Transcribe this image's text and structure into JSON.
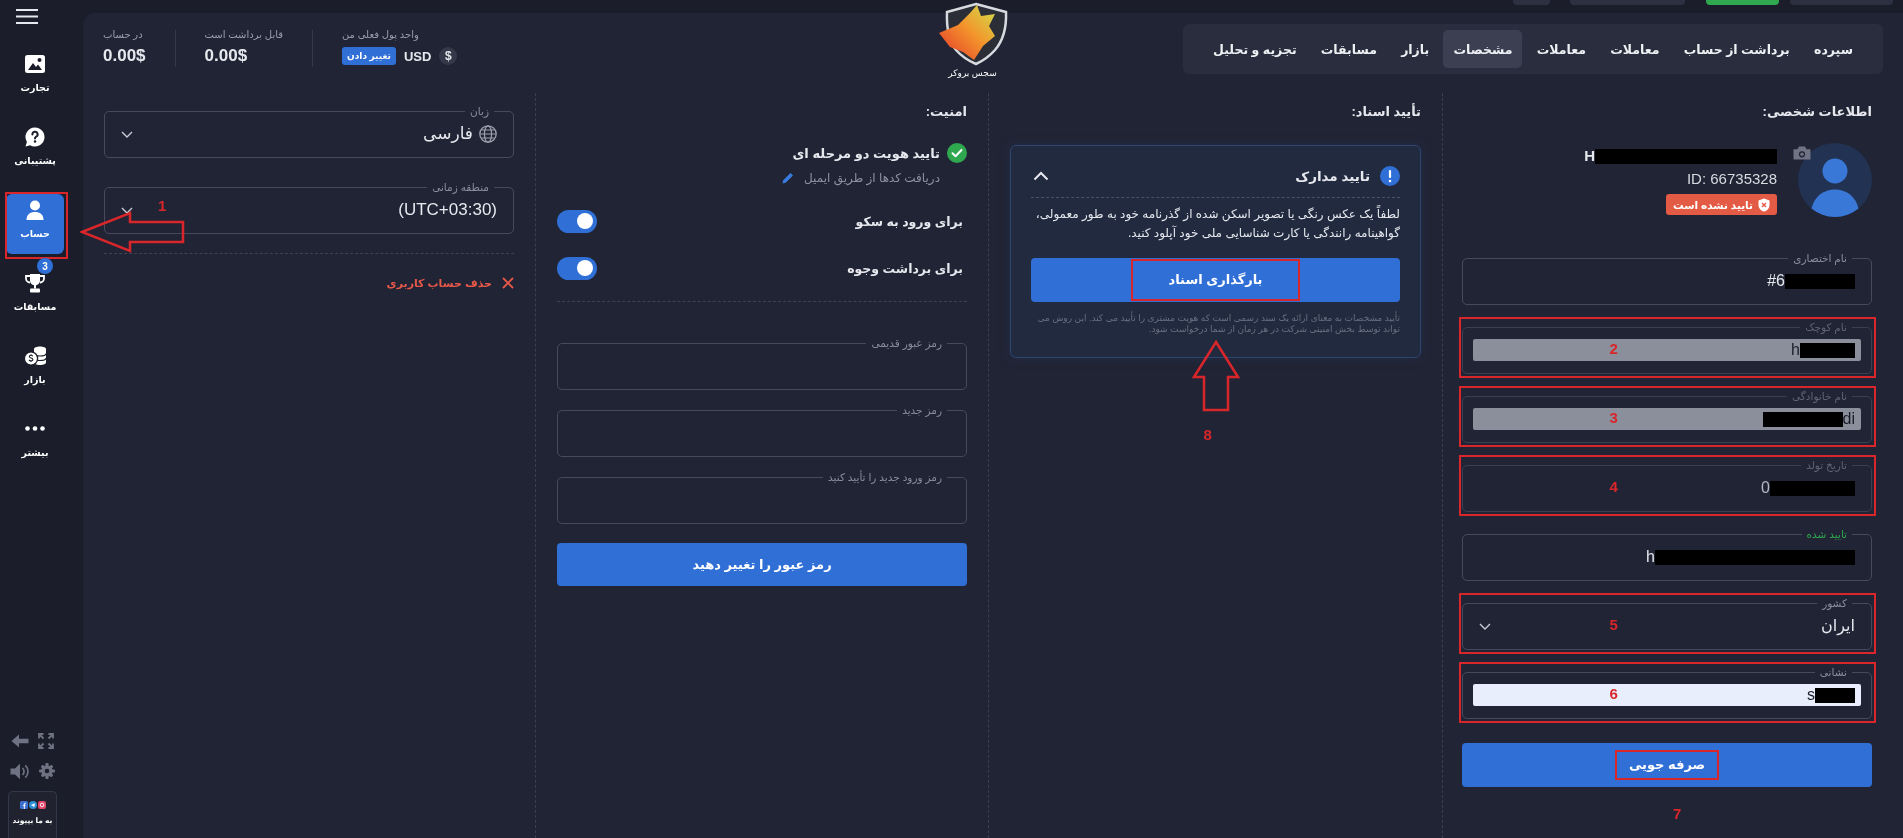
{
  "top_buttons": [
    {
      "kind": "secondary"
    },
    {
      "kind": "secondary"
    },
    {
      "kind": "primary"
    },
    {
      "kind": "secondary"
    }
  ],
  "sidebar": {
    "items": [
      {
        "label": "تجارت",
        "selected": false
      },
      {
        "label": "پشتیبانی",
        "selected": false
      },
      {
        "label": "حساب",
        "selected": true,
        "callout": {
          "number": "1",
          "arrow": true
        }
      },
      {
        "label": "مسابقات",
        "selected": false,
        "badge": "3"
      },
      {
        "label": "بازار",
        "selected": false
      },
      {
        "label": "بیشتر",
        "selected": false
      }
    ],
    "join_label": "به ما بپیوند"
  },
  "header": {
    "tabs": [
      {
        "label": "سپرده",
        "selected": false
      },
      {
        "label": "برداشت از حساب",
        "selected": false
      },
      {
        "label": "معاملات",
        "selected": false
      },
      {
        "label": "معاملات",
        "selected": false
      },
      {
        "label": "مشخصات",
        "selected": true
      },
      {
        "label": "بازار",
        "selected": false
      },
      {
        "label": "مسابقات",
        "selected": false
      },
      {
        "label": "تجزیه و تحلیل",
        "selected": false
      }
    ],
    "logo_text": "سجس بروکر",
    "balances": [
      {
        "kind": "currency",
        "label": "واحد پول فعلی من",
        "symbol": "$",
        "currency": "USD",
        "action": "تغییر دادن"
      },
      {
        "kind": "amount",
        "label": "قابل برداشت است",
        "value": "0.00$"
      },
      {
        "kind": "amount",
        "label": "در حساب",
        "value": "0.00$"
      }
    ]
  },
  "personal": {
    "title": "اطلاعات شخصی:",
    "profile": {
      "name": [
        {
          "kind": "text",
          "text": "H"
        },
        {
          "kind": "redaction"
        }
      ],
      "id": "ID: 66735328",
      "status": "تایید نشده است",
      "verified": false
    },
    "fields": [
      {
        "label": "نام اختصاری",
        "kind": "text",
        "verified": false,
        "disabled": false,
        "autofilled": false,
        "value": [
          {
            "kind": "text",
            "text": "#6"
          },
          {
            "kind": "redaction"
          }
        ]
      },
      {
        "label": "نام کوچک",
        "kind": "text",
        "verified": false,
        "disabled": true,
        "autofilled": true,
        "value": [
          {
            "kind": "text",
            "text": "h"
          },
          {
            "kind": "redaction"
          }
        ],
        "callout": {
          "number": "2"
        }
      },
      {
        "label": "نام خانوادگی",
        "kind": "text",
        "verified": false,
        "disabled": true,
        "autofilled": true,
        "value": [
          {
            "kind": "redaction"
          },
          {
            "kind": "text",
            "text": "di"
          }
        ],
        "callout": {
          "number": "3"
        }
      },
      {
        "label": "تاریخ تولد",
        "kind": "text",
        "verified": false,
        "disabled": true,
        "autofilled": false,
        "value": [
          {
            "kind": "text",
            "text": "0"
          },
          {
            "kind": "redaction"
          }
        ],
        "callout": {
          "number": "4"
        }
      },
      {
        "label": "تایید شده",
        "kind": "text",
        "verified": true,
        "disabled": false,
        "autofilled": false,
        "value": [
          {
            "kind": "text",
            "text": "h"
          },
          {
            "kind": "redaction"
          }
        ]
      },
      {
        "label": "کشور",
        "kind": "select",
        "verified": false,
        "disabled": false,
        "autofilled": false,
        "value": [
          {
            "kind": "text",
            "text": "ایران"
          }
        ],
        "callout": {
          "number": "5"
        }
      },
      {
        "label": "نشانی",
        "kind": "text",
        "verified": false,
        "disabled": false,
        "autofilled": true,
        "value": [
          {
            "kind": "text",
            "text": "s"
          },
          {
            "kind": "redaction"
          }
        ],
        "callout": {
          "number": "6"
        }
      }
    ],
    "save": {
      "label": "صرفه جویی",
      "callout": {
        "number": "7"
      }
    }
  },
  "documents": {
    "title": "تأیید اسناد:",
    "card": {
      "title": "تایید مدارک",
      "expanded": true,
      "message": "لطفاً یک عکس رنگی یا تصویر اسکن شده از گذرنامه خود به طور معمولی، گواهینامه رانندگی یا کارت شناسایی ملی خود آپلود کنید.",
      "upload": {
        "label": "بارگذاری اسناد",
        "callout": {
          "number": "8",
          "arrow": true
        }
      },
      "note": "تأیید مشخصات به معنای ارائه یک سند رسمی است که هویت مشتری را تأیید می کند. این روش می تواند توسط بخش امنیتی شرکت در هر زمان از شما درخواست شود."
    }
  },
  "security": {
    "title": "امنیت:",
    "two_factor": {
      "title": "تایید هویت دو مرحله ای",
      "enabled": true,
      "method": "دریافت کدها از طریق ایمیل"
    },
    "toggles": [
      {
        "label": "برای ورود به سکو",
        "on": true
      },
      {
        "label": "برای برداشت وجوه",
        "on": true
      }
    ],
    "password_fields": [
      {
        "label": "رمز عبور قدیمی"
      },
      {
        "label": "رمز جدید"
      },
      {
        "label": "رمز ورود جدید را تأیید کنید"
      }
    ],
    "submit": "رمز عبور را تغییر دهید"
  },
  "settings": {
    "fields": [
      {
        "kind": "language",
        "label": "زبان",
        "value": "فارسی"
      },
      {
        "kind": "select",
        "label": "منطقه زمانی",
        "value": "(UTC+03:30)"
      }
    ],
    "delete_account": "حذف حساب کاربری"
  }
}
